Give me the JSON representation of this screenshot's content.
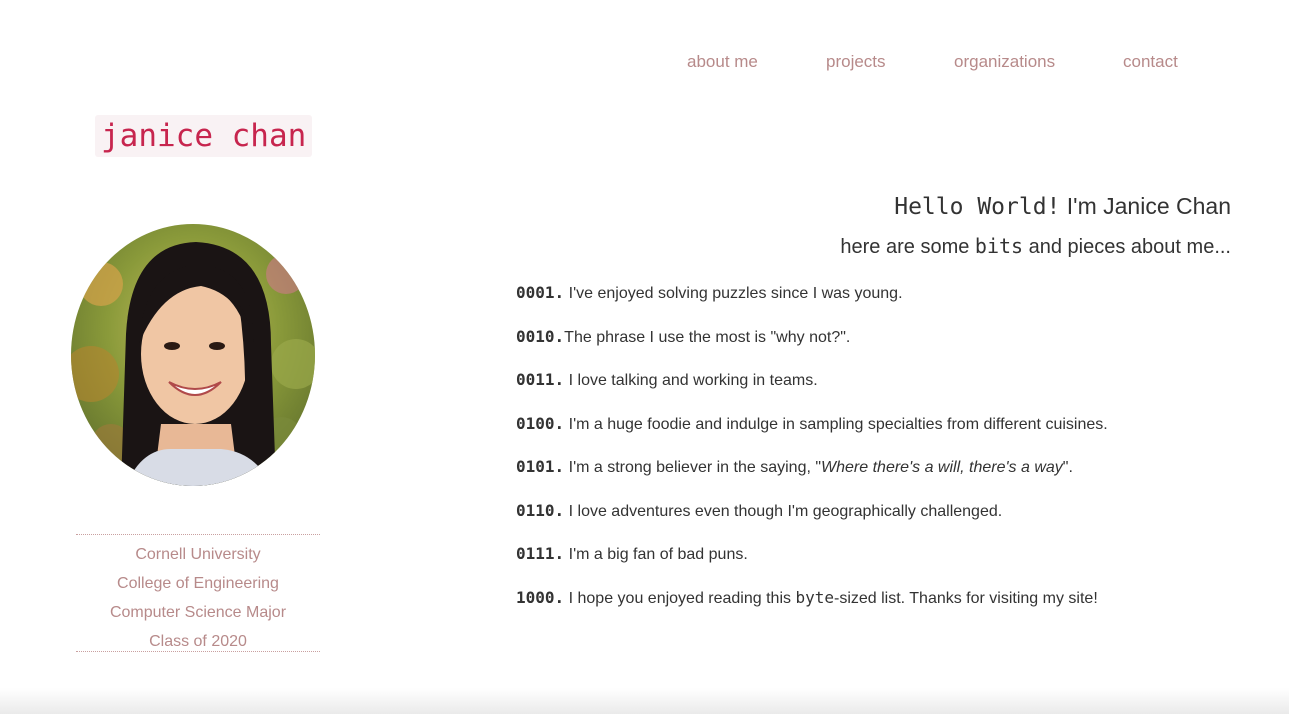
{
  "nav": {
    "items": [
      {
        "label": "about me"
      },
      {
        "label": "projects"
      },
      {
        "label": "organizations"
      },
      {
        "label": "contact"
      }
    ]
  },
  "logo": {
    "text": "janice chan"
  },
  "education": {
    "lines": [
      "Cornell University",
      "College of Engineering",
      "Computer Science Major",
      "Class of 2020"
    ]
  },
  "intro": {
    "greeting_code": "Hello World!",
    "greeting_name": " I'm Janice Chan",
    "sub_before": "here are some ",
    "sub_code": "bits",
    "sub_after": " and pieces about me..."
  },
  "facts": [
    {
      "num": "0001.",
      "text": " I've enjoyed solving puzzles since I was young."
    },
    {
      "num": "0010.",
      "text": "The phrase I use the most is \"why not?\"."
    },
    {
      "num": "0011.",
      "text": " I love talking and working in teams."
    },
    {
      "num": "0100.",
      "text": " I'm a huge foodie and indulge in sampling specialties from different cuisines."
    },
    {
      "num": "0101.",
      "text_before": " I'm a strong believer in the saying, \"",
      "quote": "Where there's a will, there's a way",
      "text_after": "\"."
    },
    {
      "num": "0110.",
      "text": " I love adventures even though I'm geographically challenged."
    },
    {
      "num": "0111.",
      "text": " I'm a big fan of bad puns."
    },
    {
      "num": "1000.",
      "text_before": " I hope you enjoyed reading this ",
      "code": "byte",
      "text_after": "-sized list. Thanks for visiting my site!"
    }
  ],
  "colors": {
    "accent": "#b78a8a",
    "logo_text": "#c7254e",
    "logo_bg": "#f9f2f4",
    "body_text": "#333333"
  }
}
